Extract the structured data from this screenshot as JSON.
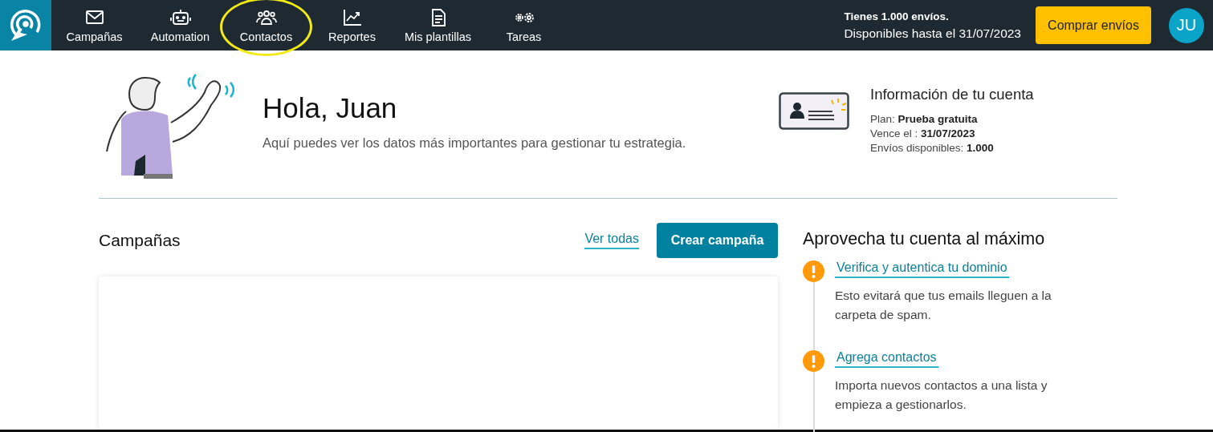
{
  "nav": {
    "items": [
      {
        "label": "Campañas",
        "highlighted": false
      },
      {
        "label": "Automation",
        "highlighted": false
      },
      {
        "label": "Contactos",
        "highlighted": true
      },
      {
        "label": "Reportes",
        "highlighted": false
      },
      {
        "label": "Mis plantillas",
        "highlighted": false
      },
      {
        "label": "Tareas",
        "highlighted": false
      }
    ]
  },
  "quota": {
    "title": "Tienes 1.000 envíos.",
    "subtitle": "Disponibles hasta el 31/07/2023"
  },
  "buy_button": "Comprar envíos",
  "avatar": "JU",
  "greeting": {
    "title": "Hola, Juan",
    "subtitle": "Aquí puedes ver los datos más importantes para gestionar tu estrategia."
  },
  "account": {
    "title": "Información de tu cuenta",
    "lines": [
      "Plan: **Prueba gratuita**",
      "Vence el : **31/07/2023**",
      "Envíos disponibles: **1.000**"
    ]
  },
  "campaigns": {
    "title": "Campañas",
    "link": "Ver todas",
    "button": "Crear campaña"
  },
  "tips": {
    "title": "Aprovecha tu cuenta al máximo",
    "items": [
      {
        "title": "Verifica y autentica tu dominio",
        "text": "Esto evitará que tus emails lleguen a la carpeta de spam."
      },
      {
        "title": "Agrega contactos",
        "text": "Importa nuevos contactos a una lista y empieza a gestionarlos."
      }
    ]
  }
}
